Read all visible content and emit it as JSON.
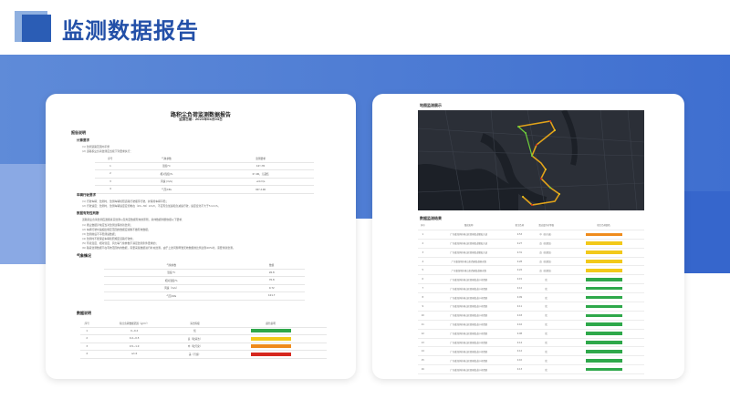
{
  "header": {
    "title": "监测数据报告"
  },
  "colors": {
    "accent": "#2350a8",
    "green": "#2ea84a",
    "yellow": "#f2c91a",
    "orange": "#ef8b1c",
    "red": "#d6281f"
  },
  "report": {
    "title": "路积尘负荷监测数据报告",
    "date": "监测日期：2023年04月04日",
    "sec1": "报告说明",
    "sub1": "计算要求",
    "sub1_lines": [
      "(1) 监测道路范围内平整",
      "(2) 道路积尘负荷监测应当按下列要求执行："
    ],
    "req_table": {
      "headers": [
        "序号",
        "气象参数",
        "监测要求"
      ],
      "rows": [
        [
          "1",
          "温度/℃",
          "10～35"
        ],
        [
          "2",
          "相对湿度/%",
          "0～90，无凝结"
        ],
        [
          "3",
          "风速 (m/s)",
          "≤4 m/s"
        ],
        [
          "4",
          "气压/kPa",
          "90～106"
        ]
      ]
    },
    "sub2": "车辆行驶要求",
    "sub2_lines": [
      "(1) 行驶车辆：监测时，监测车辆按照道路行驶顺序行驶，并保持车辆平稳；",
      "(2) 行驶速度：监测时，监测车辆速度应控制在（20~30）km/h，不应有急加速和急减速行驶，速度变化不大于5 km/h。"
    ],
    "sub3": "数据有效性判断",
    "sub3_lines": [
      "道路积尘负荷监测应遵循真实监测以及判定数据有效的原则，具体数据判断依据以下要求：",
      "(1) 扬尘数据异常应当对监测过程重新监测；",
      "(2) 车辆行驶时速超出规定范围的数据应剔除不做有效数据；",
      "(3) 监测前后不平稳测速数据；",
      "(4) 监测时不能保证车辆按照规定道路行驶的；",
      "(5) 环境温度、相对湿度、风力等气象参数不满足监测条件要求的；",
      "(6) 路段监测数据不在有效范围内的数据，需要采集数据进行补充监测。由于上述问题导致无效数据的比例达到40%时，需要重新监测。"
    ],
    "weather_title": "气象情况",
    "weather_table": {
      "headers": [
        "气象参数",
        "数值"
      ],
      "rows": [
        [
          "温度/℃",
          "26.8"
        ],
        [
          "相对湿度/%",
          "70.8"
        ],
        [
          "风速（m/s）",
          "0.72"
        ],
        [
          "气压/kPa",
          "101.7"
        ]
      ]
    },
    "data_title": "数据说明",
    "data_table": {
      "headers": [
        "序号",
        "积尘负荷数据范围（g/m²）",
        "清洁等级",
        "颜色说明"
      ],
      "rows": [
        [
          "1",
          "0~0.2",
          "优",
          "green"
        ],
        [
          "2",
          "0.2~0.5",
          "良（较清洁）",
          "yellow"
        ],
        [
          "3",
          "0.5~1.0",
          "中（较污染）",
          "orange"
        ],
        [
          "4",
          "≥1.0",
          "差（污染）",
          "red"
        ]
      ]
    }
  },
  "monitor": {
    "map_title": "地图监测展示",
    "result_title": "数据监测结果",
    "table": {
      "headers": [
        "序号",
        "路段名称",
        "积尘负荷",
        "清洁度评价等级",
        "积尘负荷颜色"
      ],
      "rows": [
        [
          "1",
          "广东省深圳市南山区西丽街道留仙大道",
          "0.53",
          "中（较污染）",
          "orange"
        ],
        [
          "2",
          "广东省深圳市南山区西丽街道留仙大道",
          "0.27",
          "良（较清洁）",
          "yellow"
        ],
        [
          "3",
          "广东省深圳市南山区西丽街道留仙大道",
          "0.31",
          "良（较清洁）",
          "yellow"
        ],
        [
          "4",
          "广东省深圳市南山区西丽街道丽水路",
          "0.28",
          "良（较清洁）",
          "yellow"
        ],
        [
          "5",
          "广东省深圳市南山区西丽街道丽水路",
          "0.22",
          "良（较清洁）",
          "yellow"
        ],
        [
          "6",
          "广东省深圳市南山区西丽街道沙河西路",
          "0.15",
          "优",
          "green"
        ],
        [
          "7",
          "广东省深圳市南山区西丽街道沙河西路",
          "0.12",
          "优",
          "green"
        ],
        [
          "8",
          "广东省深圳市南山区西丽街道沙河西路",
          "0.09",
          "优",
          "green"
        ],
        [
          "9",
          "广东省深圳市南山区西丽街道沙河西路",
          "0.11",
          "优",
          "green"
        ],
        [
          "10",
          "广东省深圳市南山区西丽街道沙河西路",
          "0.18",
          "优",
          "green"
        ],
        [
          "11",
          "广东省深圳市南山区西丽街道沙河西路",
          "0.16",
          "优",
          "green"
        ],
        [
          "12",
          "广东省深圳市南山区西丽街道沙河西路",
          "0.08",
          "优",
          "green"
        ],
        [
          "13",
          "广东省深圳市南山区西丽街道沙河西路",
          "0.14",
          "优",
          "green"
        ],
        [
          "14",
          "广东省深圳市南山区西丽街道沙河西路",
          "0.12",
          "优",
          "green"
        ],
        [
          "15",
          "广东省深圳市南山区西丽街道沙河西路",
          "0.10",
          "优",
          "green"
        ],
        [
          "16",
          "广东省深圳市南山区西丽街道沙河西路",
          "0.13",
          "优",
          "green"
        ]
      ]
    }
  }
}
